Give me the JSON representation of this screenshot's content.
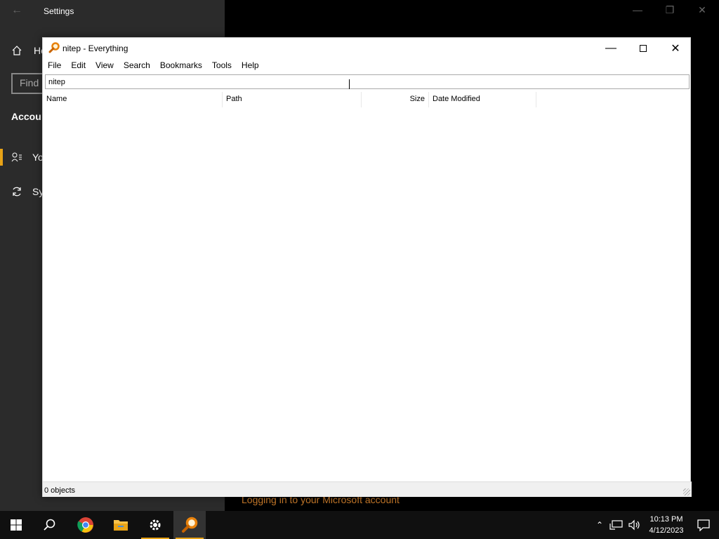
{
  "settings": {
    "title": "Settings",
    "home_label": "He",
    "find_placeholder": "Find",
    "section": "Accou",
    "nav": [
      "Yo",
      "Sy"
    ],
    "status": "Logging in to your Microsoft account"
  },
  "everything": {
    "title": "nitep - Everything",
    "menu": [
      "File",
      "Edit",
      "View",
      "Search",
      "Bookmarks",
      "Tools",
      "Help"
    ],
    "search_value": "nitep",
    "columns": [
      "Name",
      "Path",
      "Size",
      "Date Modified"
    ],
    "status": "0 objects"
  },
  "taskbar": {
    "pinned": [
      "start-button",
      "search-button",
      "chrome-icon",
      "file-explorer-icon",
      "settings-icon",
      "everything-icon"
    ],
    "time": "10:13 PM",
    "date": "4/12/2023"
  },
  "colors": {
    "accent": "#e8a317",
    "taskbar": "#101010",
    "settings_sidebar": "#2b2b2b"
  }
}
